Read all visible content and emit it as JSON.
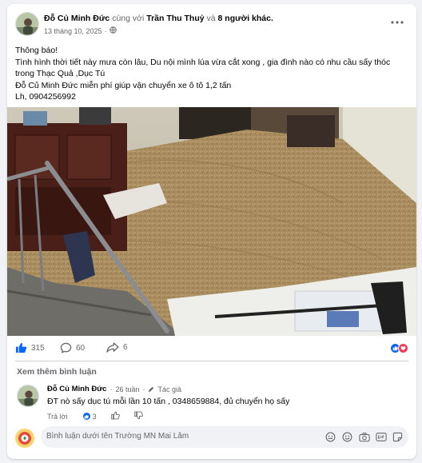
{
  "post": {
    "author": "Đỗ Củ Minh Đức",
    "with_text": "cùng với",
    "tagged": "Trần Thu Thuỷ",
    "and_text": "và",
    "others": "8 người khác.",
    "date": "13 tháng 10, 2025",
    "privacy_sep": "·",
    "body_lines": [
      "Thông báo!",
      "Tình hình thời tiết này mưa còn lâu,  Du nội mình lúa vừa cắt xong , gia đình nào có nhu cầu sấy thóc trong Thạc Quả ,Dục Tú",
      "Đỗ Củ Minh Đức miễn phí giúp vận chuyển xe ô tô 1,2 tấn",
      "Lh, 0904256992"
    ]
  },
  "stats": {
    "likes": "315",
    "comments": "60",
    "shares": "6"
  },
  "view_more": "Xem thêm bình luận",
  "comment": {
    "author": "Đỗ Củ Minh Đức",
    "time": "26 tuần",
    "badge": "Tác giả",
    "text": "ĐT nò sấy dục tú mỗi lần 10 tấn , 0348659884, đủ chuyển họ sấy",
    "reply": "Trả lời",
    "like_count": "3"
  },
  "composer": {
    "placeholder": "Bình luận dưới tên Trường MN Mai Lâm"
  },
  "colors": {
    "accent": "#0866ff",
    "love": "#f33e58",
    "muted": "#65676b"
  },
  "icons": [
    "globe-icon",
    "more-icon",
    "like-icon",
    "comment-icon",
    "share-icon",
    "love-icon",
    "pen-icon",
    "sticker-icon",
    "emoji-icon",
    "camera-icon",
    "gif-icon",
    "avatar-sticker-icon"
  ]
}
